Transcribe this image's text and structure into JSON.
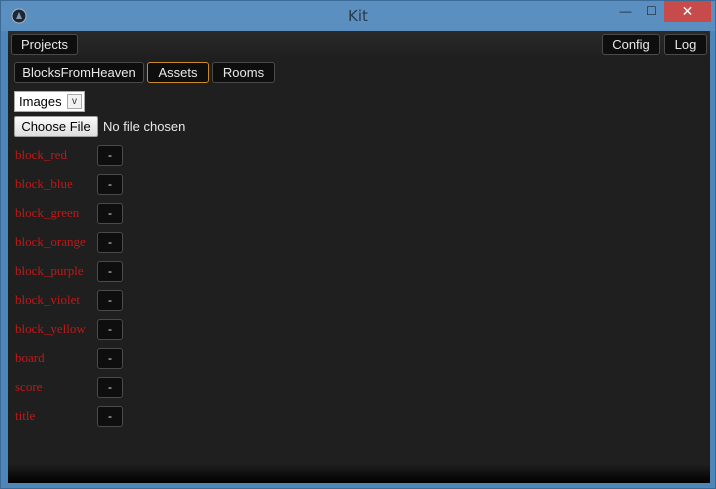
{
  "window": {
    "title": "Kit"
  },
  "window_controls": {
    "minimize": "—",
    "maximize": "☐",
    "close": "✕"
  },
  "toolbar": {
    "projects_label": "Projects",
    "config_label": "Config",
    "log_label": "Log"
  },
  "tabs": [
    {
      "label": "BlocksFromHeaven",
      "active": false
    },
    {
      "label": "Assets",
      "active": true
    },
    {
      "label": "Rooms",
      "active": false
    }
  ],
  "asset_type_select": {
    "selected": "Images",
    "arrow": "v"
  },
  "file_input": {
    "button_label": "Choose File",
    "status": "No file chosen"
  },
  "assets": [
    {
      "name": "block_red",
      "remove_label": "-"
    },
    {
      "name": "block_blue",
      "remove_label": "-"
    },
    {
      "name": "block_green",
      "remove_label": "-"
    },
    {
      "name": "block_orange",
      "remove_label": "-"
    },
    {
      "name": "block_purple",
      "remove_label": "-"
    },
    {
      "name": "block_violet",
      "remove_label": "-"
    },
    {
      "name": "block_yellow",
      "remove_label": "-"
    },
    {
      "name": "board",
      "remove_label": "-"
    },
    {
      "name": "score",
      "remove_label": "-"
    },
    {
      "name": "title",
      "remove_label": "-"
    }
  ],
  "colors": {
    "background": "#1f1f1f",
    "button_bg": "#0e0e0e",
    "asset_name": "#c01818",
    "active_tab_border": "#c98a2a",
    "titlebar": "#5b8fc0",
    "close_button": "#c74b4b"
  },
  "icons": {
    "app": "app-icon"
  }
}
